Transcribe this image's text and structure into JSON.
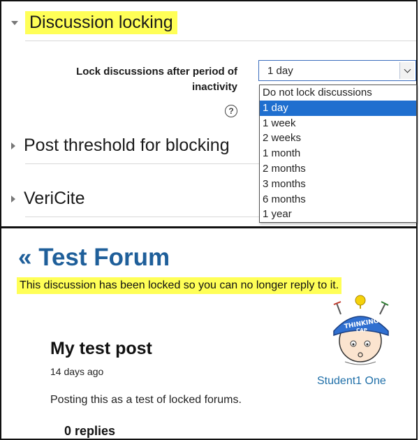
{
  "settings": {
    "discussion_locking": "Discussion locking",
    "lock_label_line1": "Lock discussions after period of",
    "lock_label_line2": "inactivity",
    "help_symbol": "?",
    "select_value": "1 day",
    "options": [
      "Do not lock discussions",
      "1 day",
      "1 week",
      "2 weeks",
      "1 month",
      "2 months",
      "3 months",
      "6 months",
      "1 year"
    ],
    "selected_index": 1,
    "post_threshold": "Post threshold for blocking",
    "vericite": "VeriCite"
  },
  "forum": {
    "title": "« Test Forum",
    "locked_notice": "This discussion has been locked so you can no longer reply to it.",
    "post_title": "My test post",
    "post_time": "14 days ago",
    "post_body": "Posting this as a test of locked forums.",
    "replies": "0 replies",
    "author": "Student1 One",
    "avatar_text": "THINKING CAP"
  },
  "colors": {
    "highlight": "#ffff57",
    "link": "#1f6fa8",
    "forum_title": "#1f5f9a",
    "selected_option": "#1f6fcf"
  }
}
